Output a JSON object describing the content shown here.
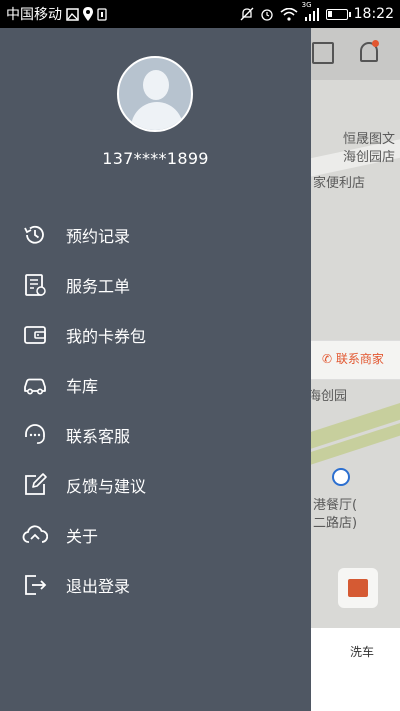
{
  "status_bar": {
    "carrier": "中国移动",
    "network": "3G",
    "time": "18:22"
  },
  "map": {
    "labels": [
      "恒晟图文",
      "海创园店",
      "家便利店",
      "海创园",
      "港餐厅(",
      "二路店)"
    ],
    "contact_button": "联系商家",
    "wash_label": "洗车",
    "accent_color": "#e2562f"
  },
  "drawer": {
    "phone": "137****1899",
    "background_color": "#4f5763",
    "menu": [
      {
        "label": "预约记录",
        "icon": "history-clock-icon"
      },
      {
        "label": "服务工单",
        "icon": "work-order-icon"
      },
      {
        "label": "我的卡券包",
        "icon": "wallet-icon"
      },
      {
        "label": "车库",
        "icon": "car-icon"
      },
      {
        "label": "联系客服",
        "icon": "customer-service-icon"
      },
      {
        "label": "反馈与建议",
        "icon": "feedback-edit-icon"
      },
      {
        "label": "关于",
        "icon": "about-cloud-icon"
      },
      {
        "label": "退出登录",
        "icon": "logout-icon"
      }
    ]
  }
}
